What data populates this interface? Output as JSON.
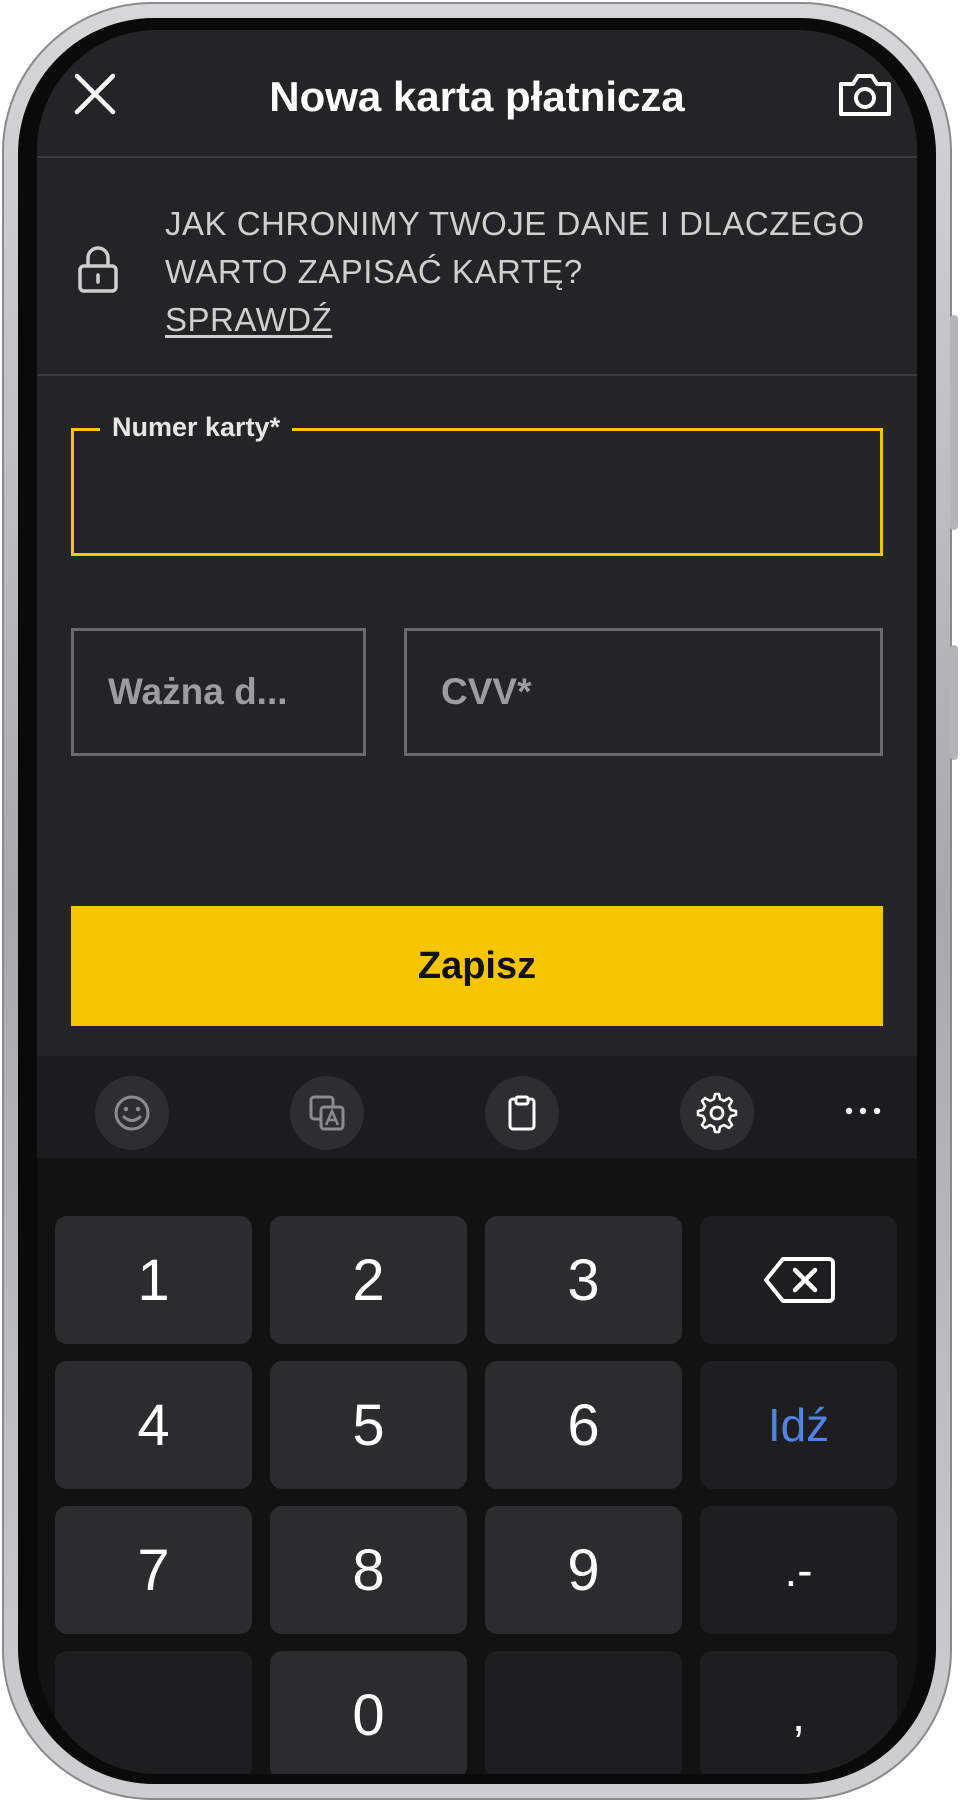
{
  "header": {
    "title": "Nowa karta płatnicza",
    "close_icon": "close-icon",
    "camera_icon": "camera-icon"
  },
  "info": {
    "lock_icon": "lock-icon",
    "text": "JAK CHRONIMY TWOJE DANE I DLACZEGO WARTO ZAPISAĆ KARTĘ?",
    "link": "SPRAWDŹ"
  },
  "form": {
    "card_number_label": "Numer karty*",
    "card_number_value": "",
    "expiry_placeholder": "Ważna d...",
    "cvv_placeholder": "CVV*",
    "save_label": "Zapisz",
    "accent_color": "#f7c600"
  },
  "keyboard": {
    "toolbar": {
      "icons": [
        "emoji-icon",
        "translate-icon",
        "clipboard-icon",
        "settings-icon",
        "more-icon"
      ]
    },
    "keys": [
      "1",
      "2",
      "3",
      "backspace",
      "4",
      "5",
      "6",
      "Idź",
      "7",
      "8",
      "9",
      ".-",
      "",
      "0",
      "",
      ","
    ],
    "go_label": "Idź",
    "go_color": "#4f83e6"
  }
}
